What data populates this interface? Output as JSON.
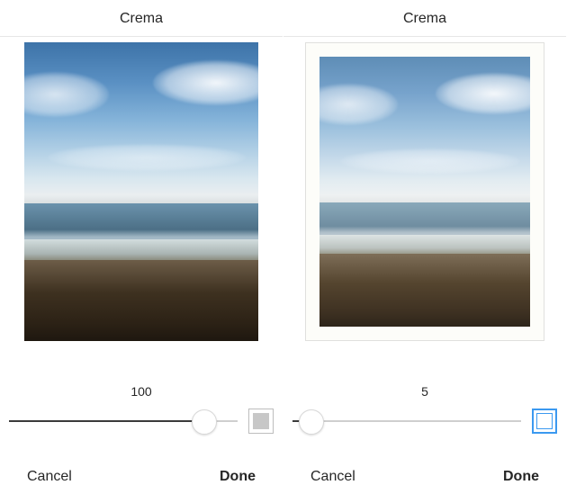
{
  "left": {
    "filter_name": "Crema",
    "slider_value": "100",
    "slider_pct": 85,
    "frame_on": false,
    "cancel_label": "Cancel",
    "done_label": "Done"
  },
  "right": {
    "filter_name": "Crema",
    "slider_value": "5",
    "slider_pct": 8,
    "frame_on": true,
    "cancel_label": "Cancel",
    "done_label": "Done"
  }
}
